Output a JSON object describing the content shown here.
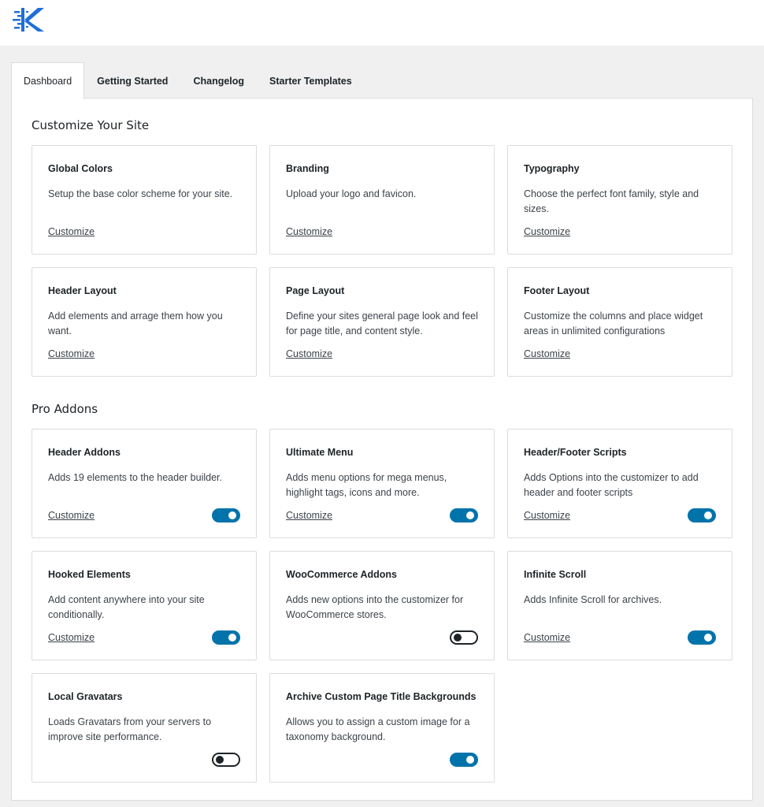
{
  "tabs": [
    {
      "label": "Dashboard"
    },
    {
      "label": "Getting Started"
    },
    {
      "label": "Changelog"
    },
    {
      "label": "Starter Templates"
    }
  ],
  "active_tab": "Dashboard",
  "customize_section": {
    "title": "Customize Your Site",
    "cards": [
      {
        "title": "Global Colors",
        "desc": "Setup the base color scheme for your site.",
        "link": "Customize"
      },
      {
        "title": "Branding",
        "desc": "Upload your logo and favicon.",
        "link": "Customize"
      },
      {
        "title": "Typography",
        "desc": "Choose the perfect font family, style and sizes.",
        "link": "Customize"
      },
      {
        "title": "Header Layout",
        "desc": "Add elements and arrage them how you want.",
        "link": "Customize"
      },
      {
        "title": "Page Layout",
        "desc": "Define your sites general page look and feel for page title, and content style.",
        "link": "Customize"
      },
      {
        "title": "Footer Layout",
        "desc": "Customize the columns and place widget areas in unlimited configurations",
        "link": "Customize"
      }
    ]
  },
  "pro_section": {
    "title": "Pro Addons",
    "cards": [
      {
        "title": "Header Addons",
        "desc": "Adds 19 elements to the header builder.",
        "link": "Customize",
        "enabled": true
      },
      {
        "title": "Ultimate Menu",
        "desc": "Adds menu options for mega menus, highlight tags, icons and more.",
        "link": "Customize",
        "enabled": true
      },
      {
        "title": "Header/Footer Scripts",
        "desc": "Adds Options into the customizer to add header and footer scripts",
        "link": "Customize",
        "enabled": true
      },
      {
        "title": "Hooked Elements",
        "desc": "Add content anywhere into your site conditionally.",
        "link": "Customize",
        "enabled": true
      },
      {
        "title": "WooCommerce Addons",
        "desc": "Adds new options into the customizer for WooCommerce stores.",
        "link": "",
        "enabled": false
      },
      {
        "title": "Infinite Scroll",
        "desc": "Adds Infinite Scroll for archives.",
        "link": "Customize",
        "enabled": true
      },
      {
        "title": "Local Gravatars",
        "desc": "Loads Gravatars from your servers to improve site performance.",
        "link": "",
        "enabled": false
      },
      {
        "title": "Archive Custom Page Title Backgrounds",
        "desc": "Allows you to assign a custom image for a taxonomy background.",
        "link": "",
        "enabled": true
      }
    ]
  },
  "colors": {
    "accent": "#0073aa",
    "logo": "#1e6fd9"
  }
}
